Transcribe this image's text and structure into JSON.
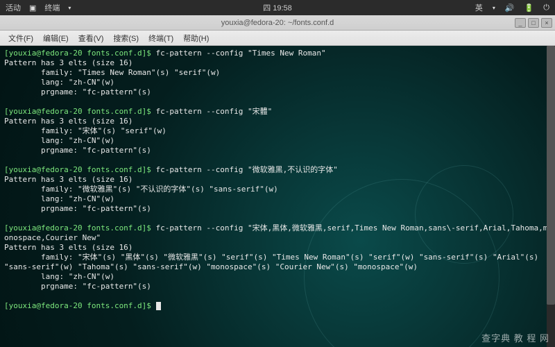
{
  "topbar": {
    "activities": "活动",
    "app": "终端",
    "clock": "四 19:58",
    "lang": "英",
    "status_icons": [
      "volume-icon",
      "battery-icon",
      "power-icon"
    ]
  },
  "titlebar": {
    "title": "youxia@fedora-20: ~/fonts.conf.d",
    "min": "_",
    "max": "□",
    "close": "×"
  },
  "menubar": {
    "items": [
      "文件(F)",
      "编辑(E)",
      "查看(V)",
      "搜索(S)",
      "终端(T)",
      "帮助(H)"
    ]
  },
  "terminal": {
    "prompt": "[youxia@fedora-20 fonts.conf.d]$ ",
    "blocks": [
      {
        "cmd": "fc-pattern --config \"Times New Roman\"",
        "out": "Pattern has 3 elts (size 16)\n        family: \"Times New Roman\"(s) \"serif\"(w)\n        lang: \"zh-CN\"(w)\n        prgname: \"fc-pattern\"(s)\n"
      },
      {
        "cmd": "fc-pattern --config \"宋體\"",
        "out": "Pattern has 3 elts (size 16)\n        family: \"宋体\"(s) \"serif\"(w)\n        lang: \"zh-CN\"(w)\n        prgname: \"fc-pattern\"(s)\n"
      },
      {
        "cmd": "fc-pattern --config \"微软雅黑,不认识的字体\"",
        "out": "Pattern has 3 elts (size 16)\n        family: \"微软雅黑\"(s) \"不认识的字体\"(s) \"sans-serif\"(w)\n        lang: \"zh-CN\"(w)\n        prgname: \"fc-pattern\"(s)\n"
      },
      {
        "cmd": "fc-pattern --config \"宋体,黑体,微软雅黑,serif,Times New Roman,sans\\-serif,Arial,Tahoma,monospace,Courier New\"",
        "out": "Pattern has 3 elts (size 16)\n        family: \"宋体\"(s) \"黑体\"(s) \"微软雅黑\"(s) \"serif\"(s) \"Times New Roman\"(s) \"serif\"(w) \"sans-serif\"(s) \"Arial\"(s) \"sans-serif\"(w) \"Tahoma\"(s) \"sans-serif\"(w) \"monospace\"(s) \"Courier New\"(s) \"monospace\"(w)\n        lang: \"zh-CN\"(w)\n        prgname: \"fc-pattern\"(s)\n"
      }
    ]
  },
  "watermark": "查字典  教 程 网"
}
